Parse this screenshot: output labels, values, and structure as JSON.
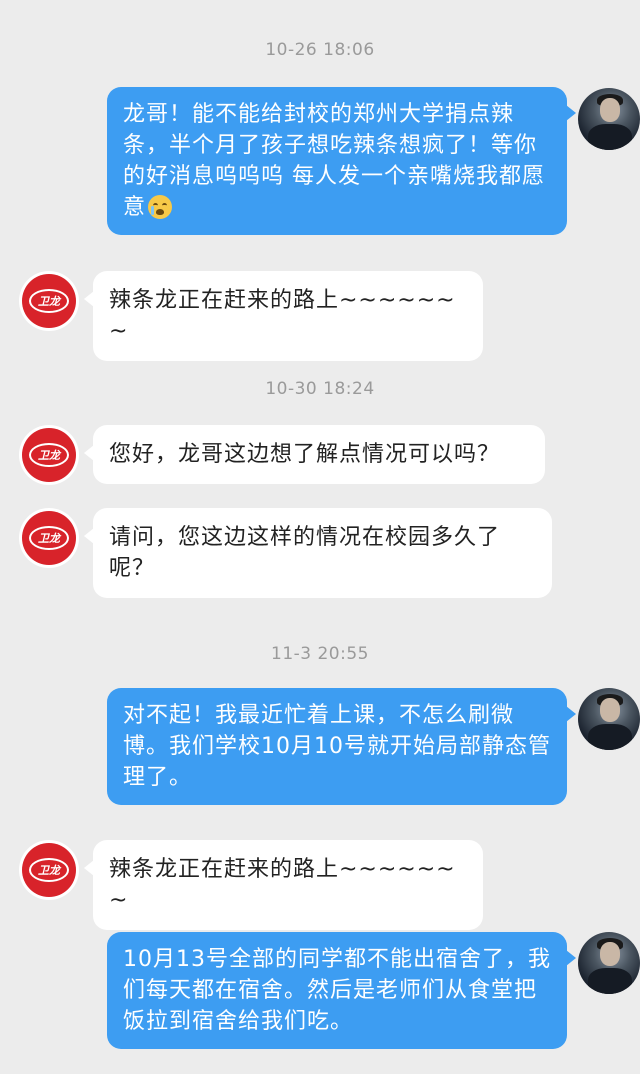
{
  "timestamps": [
    "10-26 18:06",
    "10-30 18:24",
    "11-3 20:55"
  ],
  "logo_text": "卫龙",
  "messages": [
    {
      "from": "user",
      "text": "龙哥！能不能给封校的郑州大学捐点辣条，半个月了孩子想吃辣条想疯了！等你的好消息呜呜呜 每人发一个亲嘴烧我都愿意",
      "emoji": "crying-face-icon"
    },
    {
      "from": "weilong",
      "text": "辣条龙正在赶来的路上~~~~~~~"
    },
    {
      "from": "weilong",
      "text": "您好，龙哥这边想了解点情况可以吗？"
    },
    {
      "from": "weilong",
      "text": "请问，您这边这样的情况在校园多久了呢？"
    },
    {
      "from": "user",
      "text": "对不起！我最近忙着上课，不怎么刷微博。我们学校10月10号就开始局部静态管理了。"
    },
    {
      "from": "weilong",
      "text": "辣条龙正在赶来的路上~~~~~~~"
    },
    {
      "from": "user",
      "text": "10月13号全部的同学都不能出宿舍了，我们每天都在宿舍。然后是老师们从食堂把饭拉到宿舍给我们吃。"
    }
  ],
  "colors": {
    "outgoing_bubble": "#3d9df2",
    "incoming_bubble": "#ffffff",
    "background": "#ececec",
    "logo_red": "#d8232a"
  }
}
